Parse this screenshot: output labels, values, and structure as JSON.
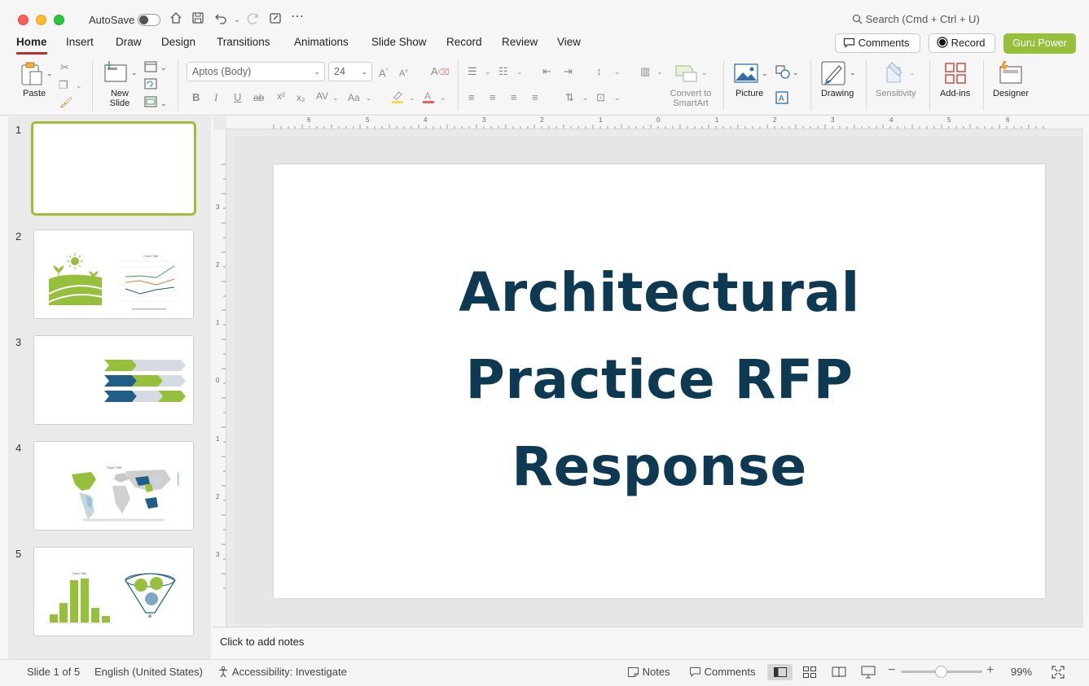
{
  "titlebar": {
    "autosave_label": "AutoSave",
    "search_placeholder": "Search (Cmd + Ctrl + U)"
  },
  "tabs": [
    "Home",
    "Insert",
    "Draw",
    "Design",
    "Transitions",
    "Animations",
    "Slide Show",
    "Record",
    "Review",
    "View"
  ],
  "header_buttons": {
    "comments": "Comments",
    "record": "Record",
    "guru": "Guru Power"
  },
  "ribbon": {
    "paste": "Paste",
    "new_slide": "New Slide",
    "font_name": "Aptos (Body)",
    "font_size": "24",
    "convert_smartart": "Convert to SmartArt",
    "picture": "Picture",
    "drawing": "Drawing",
    "sensitivity": "Sensitivity",
    "addins": "Add-ins",
    "designer": "Designer"
  },
  "slides": {
    "numbers": [
      "1",
      "2",
      "3",
      "4",
      "5"
    ],
    "thumb2_chart_title": "Chart Title",
    "thumb4_chart_title": "Chart Title",
    "thumb5_chart_title": "Chart Title"
  },
  "slide": {
    "title_line1": "Architectural",
    "title_line2": "Practice RFP",
    "title_line3": "Response",
    "title_color": "#0d3a52"
  },
  "ruler": {
    "h_ticks": [
      "6",
      "5",
      "4",
      "3",
      "2",
      "1",
      "0",
      "1",
      "2",
      "3",
      "4",
      "5",
      "6"
    ],
    "v_ticks": [
      "3",
      "2",
      "1",
      "0",
      "1",
      "2",
      "3"
    ]
  },
  "notes_placeholder": "Click to add notes",
  "status": {
    "slide_count": "Slide 1 of 5",
    "language": "English (United States)",
    "accessibility": "Accessibility: Investigate",
    "notes": "Notes",
    "comments": "Comments",
    "zoom": "99%"
  },
  "colors": {
    "accent_green": "#96bf3c",
    "dark_blue": "#1f5f87",
    "tab_underline": "#b8322f"
  }
}
